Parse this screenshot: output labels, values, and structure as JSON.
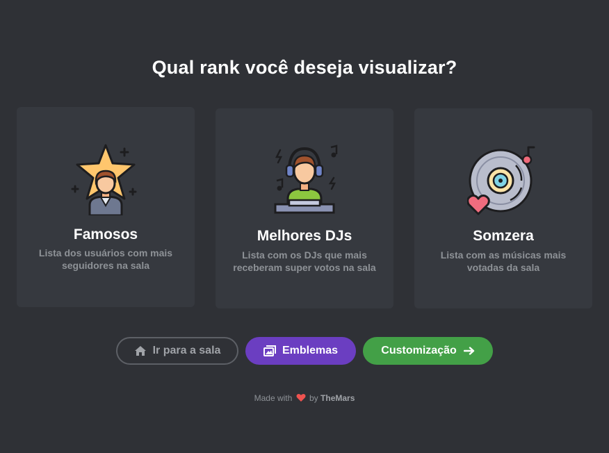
{
  "page": {
    "title": "Qual rank você deseja visualizar?"
  },
  "cards": [
    {
      "name": "Famosos",
      "description": "Lista dos usuários com mais seguidores na sala",
      "icon": "famous-star-person-icon"
    },
    {
      "name": "Melhores DJs",
      "description": "Lista com os DJs que mais receberam super votos na sala",
      "icon": "dj-headphones-icon"
    },
    {
      "name": "Somzera",
      "description": "Lista com as músicas mais votadas da sala",
      "icon": "vinyl-heart-icon"
    }
  ],
  "buttons": {
    "home_label": "Ir para a sala",
    "badges_label": "Emblemas",
    "custom_label": "Customização"
  },
  "footer": {
    "made_with": "Made with",
    "by": "by",
    "author": "TheMars"
  },
  "colors": {
    "background": "#2f3136",
    "card": "#36393f",
    "badges_button": "#6b3ec1",
    "custom_button": "#43a047",
    "heart": "#ef5350"
  }
}
